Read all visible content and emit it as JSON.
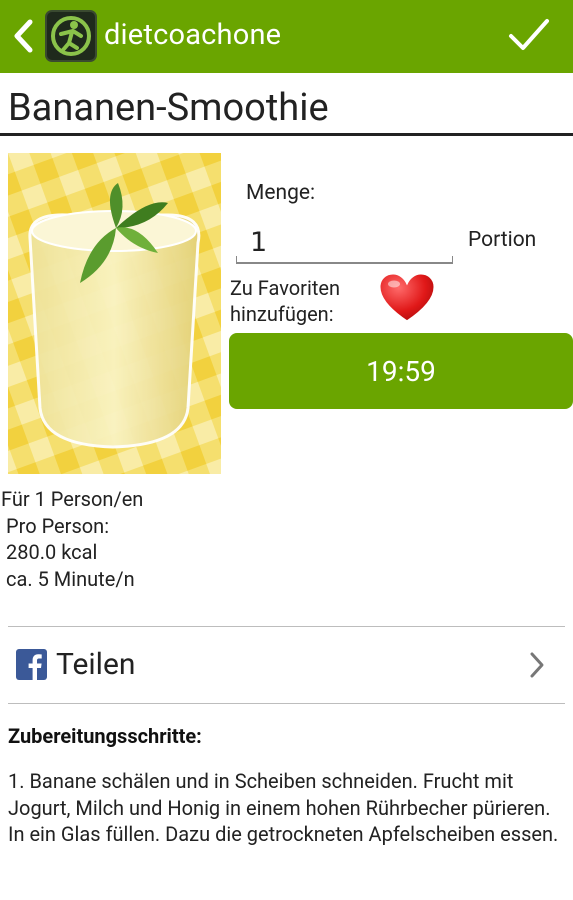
{
  "app": {
    "title": "dietcoachone"
  },
  "recipe": {
    "title": "Bananen-Smoothie",
    "photo_icon": "smoothie-photo"
  },
  "quantity": {
    "label": "Menge:",
    "value": "1",
    "unit": "Portion"
  },
  "favorites": {
    "label": "Zu Favoriten hinzufügen:",
    "icon": "heart-icon"
  },
  "time_button": {
    "label": "19:59"
  },
  "info": {
    "persons": "Für 1 Person/en",
    "per_person": "Pro Person:",
    "calories": "280.0 kcal",
    "duration": "ca. 5 Minute/n"
  },
  "share": {
    "label": "Teilen",
    "icon": "facebook-icon"
  },
  "steps": {
    "heading": "Zubereitungsschritte:",
    "text": "1. Banane schälen und in Scheiben schneiden. Frucht mit Jogurt, Milch und Honig in einem hohen Rührbecher pürieren. In ein Glas füllen. Dazu die getrockneten Apfelscheiben essen."
  },
  "colors": {
    "accent": "#6aa500",
    "text": "#222222",
    "divider": "#bdbdbd"
  }
}
